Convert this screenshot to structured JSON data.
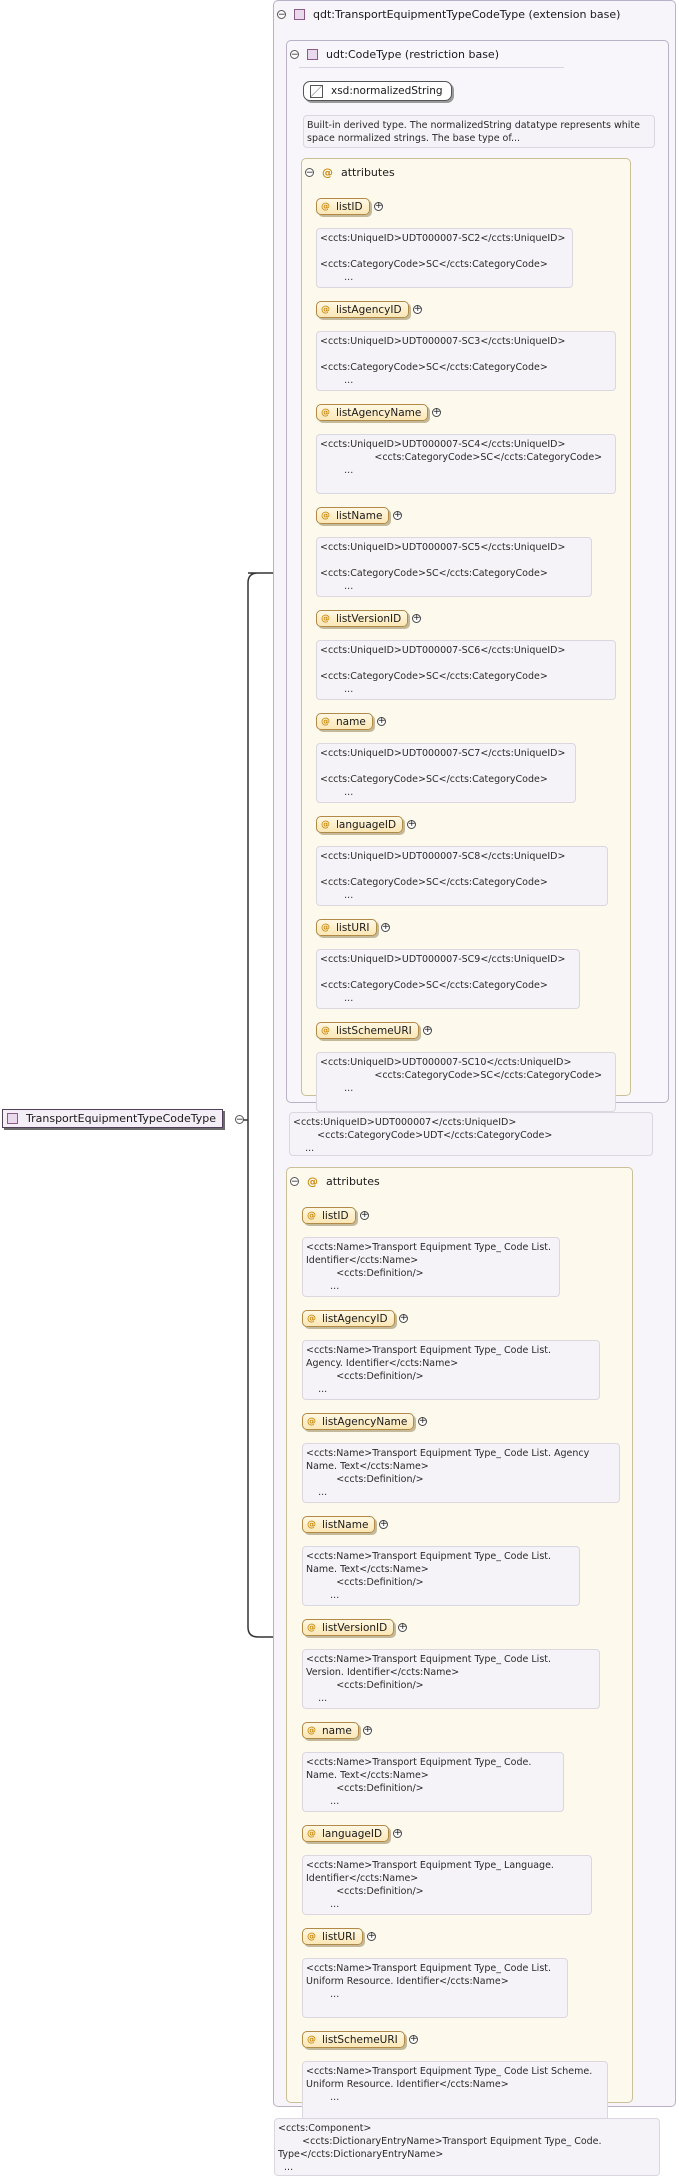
{
  "root": {
    "label": "TransportEquipmentTypeCodeType"
  },
  "extension": {
    "title": "qdt:TransportEquipmentTypeCodeType (extension base)"
  },
  "restriction": {
    "title": "udt:CodeType (restriction base)"
  },
  "base_type": {
    "label": "xsd:normalizedString",
    "doc": "Built-in derived type. The normalizedString datatype represents white\nspace normalized strings. The base type of..."
  },
  "restriction_attributes": {
    "title": "attributes",
    "items": [
      {
        "name": "listID",
        "doc": "<ccts:UniqueID>UDT000007-SC2</ccts:UniqueID>\n\n<ccts:CategoryCode>SC</ccts:CategoryCode>\n        ..."
      },
      {
        "name": "listAgencyID",
        "doc": "<ccts:UniqueID>UDT000007-SC3</ccts:UniqueID>\n\n<ccts:CategoryCode>SC</ccts:CategoryCode>\n        ..."
      },
      {
        "name": "listAgencyName",
        "doc": "<ccts:UniqueID>UDT000007-SC4</ccts:UniqueID>\n                  <ccts:CategoryCode>SC</ccts:CategoryCode>\n        ..."
      },
      {
        "name": "listName",
        "doc": "<ccts:UniqueID>UDT000007-SC5</ccts:UniqueID>\n\n<ccts:CategoryCode>SC</ccts:CategoryCode>\n        ..."
      },
      {
        "name": "listVersionID",
        "doc": "<ccts:UniqueID>UDT000007-SC6</ccts:UniqueID>\n\n<ccts:CategoryCode>SC</ccts:CategoryCode>\n        ..."
      },
      {
        "name": "name",
        "doc": "<ccts:UniqueID>UDT000007-SC7</ccts:UniqueID>\n\n<ccts:CategoryCode>SC</ccts:CategoryCode>\n        ..."
      },
      {
        "name": "languageID",
        "doc": "<ccts:UniqueID>UDT000007-SC8</ccts:UniqueID>\n\n<ccts:CategoryCode>SC</ccts:CategoryCode>\n        ..."
      },
      {
        "name": "listURI",
        "doc": "<ccts:UniqueID>UDT000007-SC9</ccts:UniqueID>\n\n<ccts:CategoryCode>SC</ccts:CategoryCode>\n        ..."
      },
      {
        "name": "listSchemeURI",
        "doc": "<ccts:UniqueID>UDT000007-SC10</ccts:UniqueID>\n                  <ccts:CategoryCode>SC</ccts:CategoryCode>\n        ..."
      }
    ]
  },
  "restriction_doc": "<ccts:UniqueID>UDT000007</ccts:UniqueID>\n        <ccts:CategoryCode>UDT</ccts:CategoryCode>\n    ...",
  "extension_attributes": {
    "title": "attributes",
    "items": [
      {
        "name": "listID",
        "doc": "<ccts:Name>Transport Equipment Type_ Code List.\nIdentifier</ccts:Name>\n          <ccts:Definition/>\n        ..."
      },
      {
        "name": "listAgencyID",
        "doc": "<ccts:Name>Transport Equipment Type_ Code List.\nAgency. Identifier</ccts:Name>\n          <ccts:Definition/>\n    ..."
      },
      {
        "name": "listAgencyName",
        "doc": "<ccts:Name>Transport Equipment Type_ Code List. Agency\nName. Text</ccts:Name>\n          <ccts:Definition/>\n    ..."
      },
      {
        "name": "listName",
        "doc": "<ccts:Name>Transport Equipment Type_ Code List.\nName. Text</ccts:Name>\n          <ccts:Definition/>\n        ..."
      },
      {
        "name": "listVersionID",
        "doc": "<ccts:Name>Transport Equipment Type_ Code List.\nVersion. Identifier</ccts:Name>\n          <ccts:Definition/>\n    ..."
      },
      {
        "name": "name",
        "doc": "<ccts:Name>Transport Equipment Type_ Code.\nName. Text</ccts:Name>\n          <ccts:Definition/>\n        ..."
      },
      {
        "name": "languageID",
        "doc": "<ccts:Name>Transport Equipment Type_ Language.\nIdentifier</ccts:Name>\n          <ccts:Definition/>\n        ..."
      },
      {
        "name": "listURI",
        "doc": "<ccts:Name>Transport Equipment Type_ Code List.\nUniform Resource. Identifier</ccts:Name>\n        ..."
      },
      {
        "name": "listSchemeURI",
        "doc": "<ccts:Name>Transport Equipment Type_ Code List Scheme.\nUniform Resource. Identifier</ccts:Name>\n        ..."
      }
    ]
  },
  "extension_doc": "<ccts:Component>\n        <ccts:DictionaryEntryName>Transport Equipment Type_ Code.\nType</ccts:DictionaryEntryName>\n  ..."
}
